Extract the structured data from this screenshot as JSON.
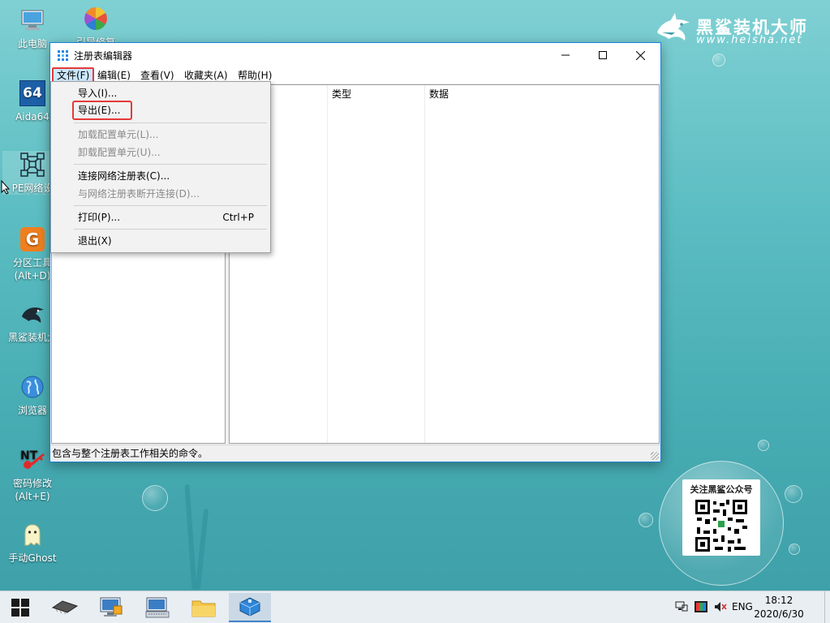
{
  "desktop": {
    "icons": [
      {
        "label": "此电脑"
      },
      {
        "label": "引导修复"
      },
      {
        "label": "Aida64"
      },
      {
        "label": "PE网络设"
      },
      {
        "label": "分区工具",
        "label2": "(Alt+D)"
      },
      {
        "label": "黑鲨装机大"
      },
      {
        "label": "浏览器"
      },
      {
        "label": "密码修改",
        "label2": "(Alt+E)"
      },
      {
        "label": "手动Ghost"
      }
    ],
    "aida_badge": "64"
  },
  "brand": {
    "name": "黑鲨装机大师",
    "url": "www.heisha.net"
  },
  "qr": {
    "title": "关注黑鲨公众号"
  },
  "window": {
    "title": "注册表编辑器",
    "menus": [
      "文件(F)",
      "编辑(E)",
      "查看(V)",
      "收藏夹(A)",
      "帮助(H)"
    ],
    "columns": [
      "类型",
      "数据"
    ],
    "status": "包含与整个注册表工作相关的命令。"
  },
  "file_menu": {
    "items": [
      {
        "label": "导入(I)...",
        "enabled": true
      },
      {
        "label": "导出(E)...",
        "enabled": true,
        "highlighted": true
      },
      {
        "label": "加载配置单元(L)...",
        "enabled": false
      },
      {
        "label": "卸载配置单元(U)...",
        "enabled": false
      },
      {
        "label": "连接网络注册表(C)...",
        "enabled": true
      },
      {
        "label": "与网络注册表断开连接(D)...",
        "enabled": false
      },
      {
        "label": "打印(P)...",
        "enabled": true,
        "shortcut": "Ctrl+P"
      },
      {
        "label": "退出(X)",
        "enabled": true
      }
    ]
  },
  "taskbar": {
    "lang": "ENG",
    "time": "18:12",
    "date": "2020/6/30"
  },
  "colors": {
    "accent": "#1883d7",
    "highlight_box": "#e43a3a",
    "menu_open_bg": "#cce8ff",
    "desktop_top": "#7fd0d3",
    "desktop_bottom": "#3d9ea7"
  }
}
